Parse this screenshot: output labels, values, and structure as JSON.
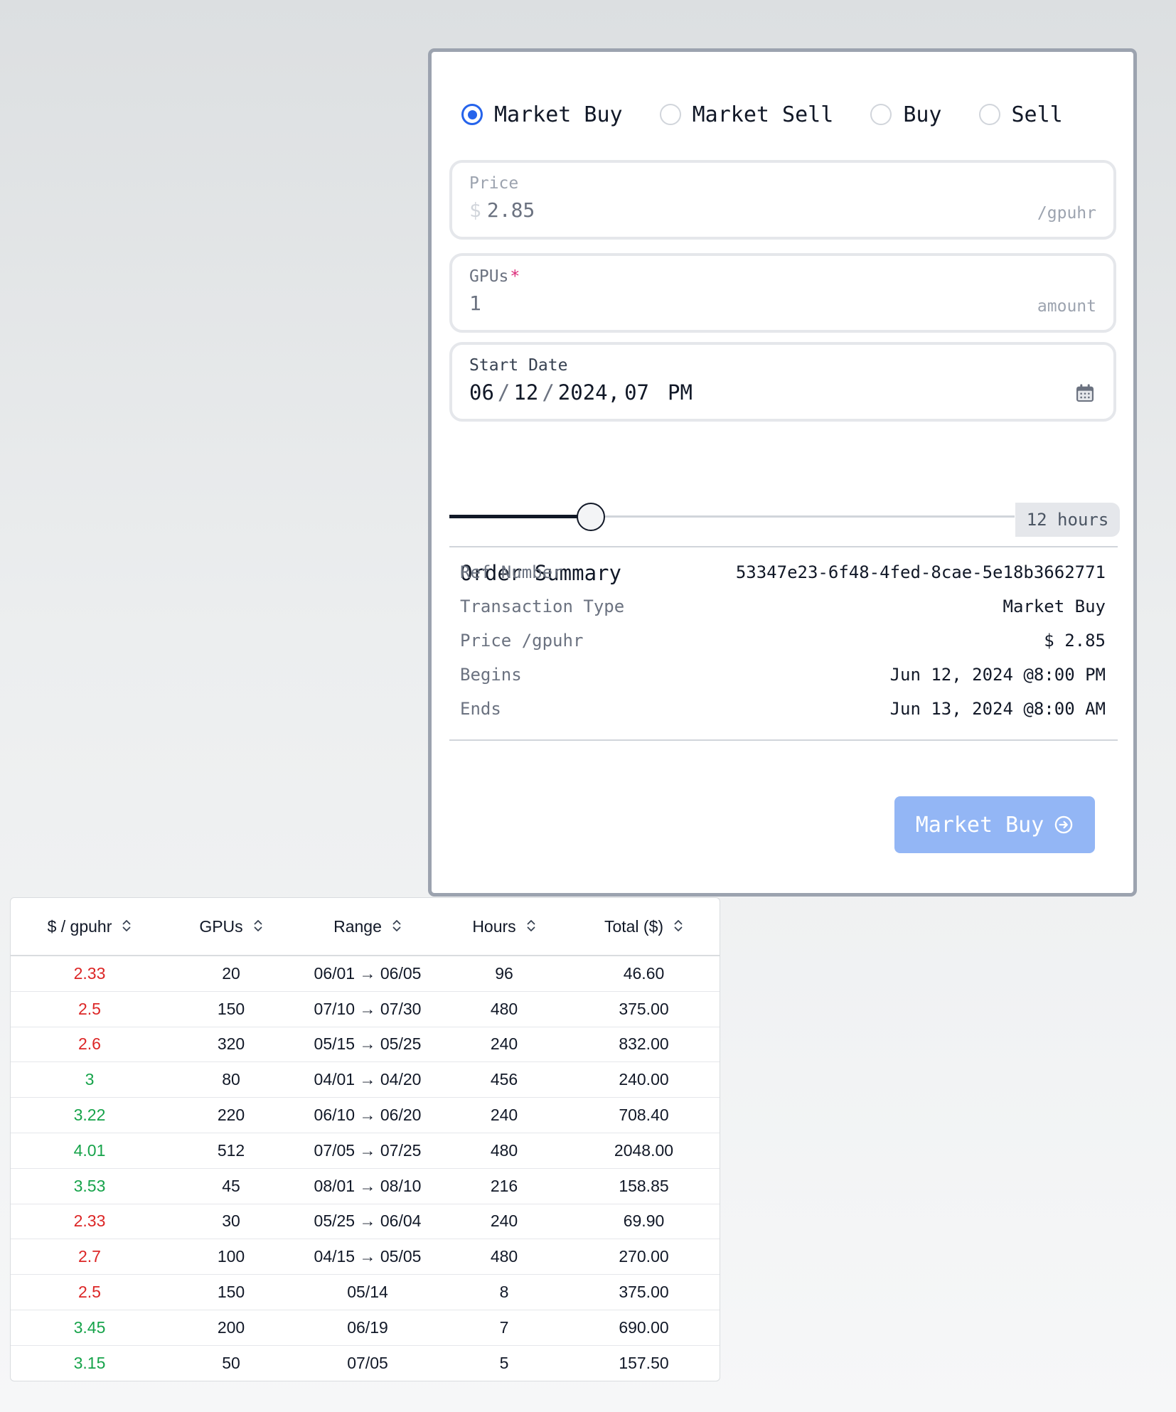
{
  "order_form": {
    "order_types": [
      {
        "label": "Market Buy",
        "selected": true
      },
      {
        "label": "Market Sell",
        "selected": false
      },
      {
        "label": "Buy",
        "selected": false
      },
      {
        "label": "Sell",
        "selected": false
      }
    ],
    "price": {
      "label": "Price",
      "currency": "$",
      "value": "2.85",
      "suffix": "/gpuhr"
    },
    "gpus": {
      "label": "GPUs",
      "required_mark": "*",
      "value": "1",
      "suffix": "amount"
    },
    "start_date": {
      "label": "Start Date",
      "month": "06",
      "day": "12",
      "year": "2024",
      "hour": "07",
      "ampm": "PM",
      "icon": "calendar-icon"
    },
    "duration": {
      "label": "12 hours",
      "fraction": 0.25
    },
    "summary": {
      "title": "Order Summary",
      "rows": [
        {
          "key": "Ref Number",
          "value": "53347e23-6f48-4fed-8cae-5e18b3662771"
        },
        {
          "key": "Transaction Type",
          "value": "Market Buy"
        },
        {
          "key": "Price /gpuhr",
          "value": "$ 2.85"
        },
        {
          "key": "Begins",
          "value": "Jun 12, 2024 @8:00 PM"
        },
        {
          "key": "Ends",
          "value": "Jun 13, 2024 @8:00 AM"
        }
      ]
    },
    "submit": {
      "label": "Market Buy",
      "icon": "arrow-right-circle-icon"
    }
  },
  "orders_table": {
    "columns": [
      "$ / gpuhr",
      "GPUs",
      "Range",
      "Hours",
      "Total ($)"
    ],
    "rows": [
      {
        "price": "2.33",
        "trend": "down",
        "gpus": "20",
        "range": "06/01 → 06/05",
        "hours": "96",
        "total": "46.60"
      },
      {
        "price": "2.5",
        "trend": "down",
        "gpus": "150",
        "range": "07/10 → 07/30",
        "hours": "480",
        "total": "375.00"
      },
      {
        "price": "2.6",
        "trend": "down",
        "gpus": "320",
        "range": "05/15 → 05/25",
        "hours": "240",
        "total": "832.00"
      },
      {
        "price": "3",
        "trend": "up",
        "gpus": "80",
        "range": "04/01 → 04/20",
        "hours": "456",
        "total": "240.00"
      },
      {
        "price": "3.22",
        "trend": "up",
        "gpus": "220",
        "range": "06/10 → 06/20",
        "hours": "240",
        "total": "708.40"
      },
      {
        "price": "4.01",
        "trend": "up",
        "gpus": "512",
        "range": "07/05 → 07/25",
        "hours": "480",
        "total": "2048.00"
      },
      {
        "price": "3.53",
        "trend": "up",
        "gpus": "45",
        "range": "08/01 → 08/10",
        "hours": "216",
        "total": "158.85"
      },
      {
        "price": "2.33",
        "trend": "down",
        "gpus": "30",
        "range": "05/25 → 06/04",
        "hours": "240",
        "total": "69.90"
      },
      {
        "price": "2.7",
        "trend": "down",
        "gpus": "100",
        "range": "04/15 → 05/05",
        "hours": "480",
        "total": "270.00"
      },
      {
        "price": "2.5",
        "trend": "down",
        "gpus": "150",
        "range": "05/14",
        "hours": "8",
        "total": "375.00"
      },
      {
        "price": "3.45",
        "trend": "up",
        "gpus": "200",
        "range": "06/19",
        "hours": "7",
        "total": "690.00"
      },
      {
        "price": "3.15",
        "trend": "up",
        "gpus": "50",
        "range": "07/05",
        "hours": "5",
        "total": "157.50"
      }
    ]
  },
  "colors": {
    "accent": "#2563eb",
    "button_disabled": "#93b6f5",
    "price_down": "#dc2626",
    "price_up": "#16a34a",
    "panel_border": "#9ca3af"
  }
}
